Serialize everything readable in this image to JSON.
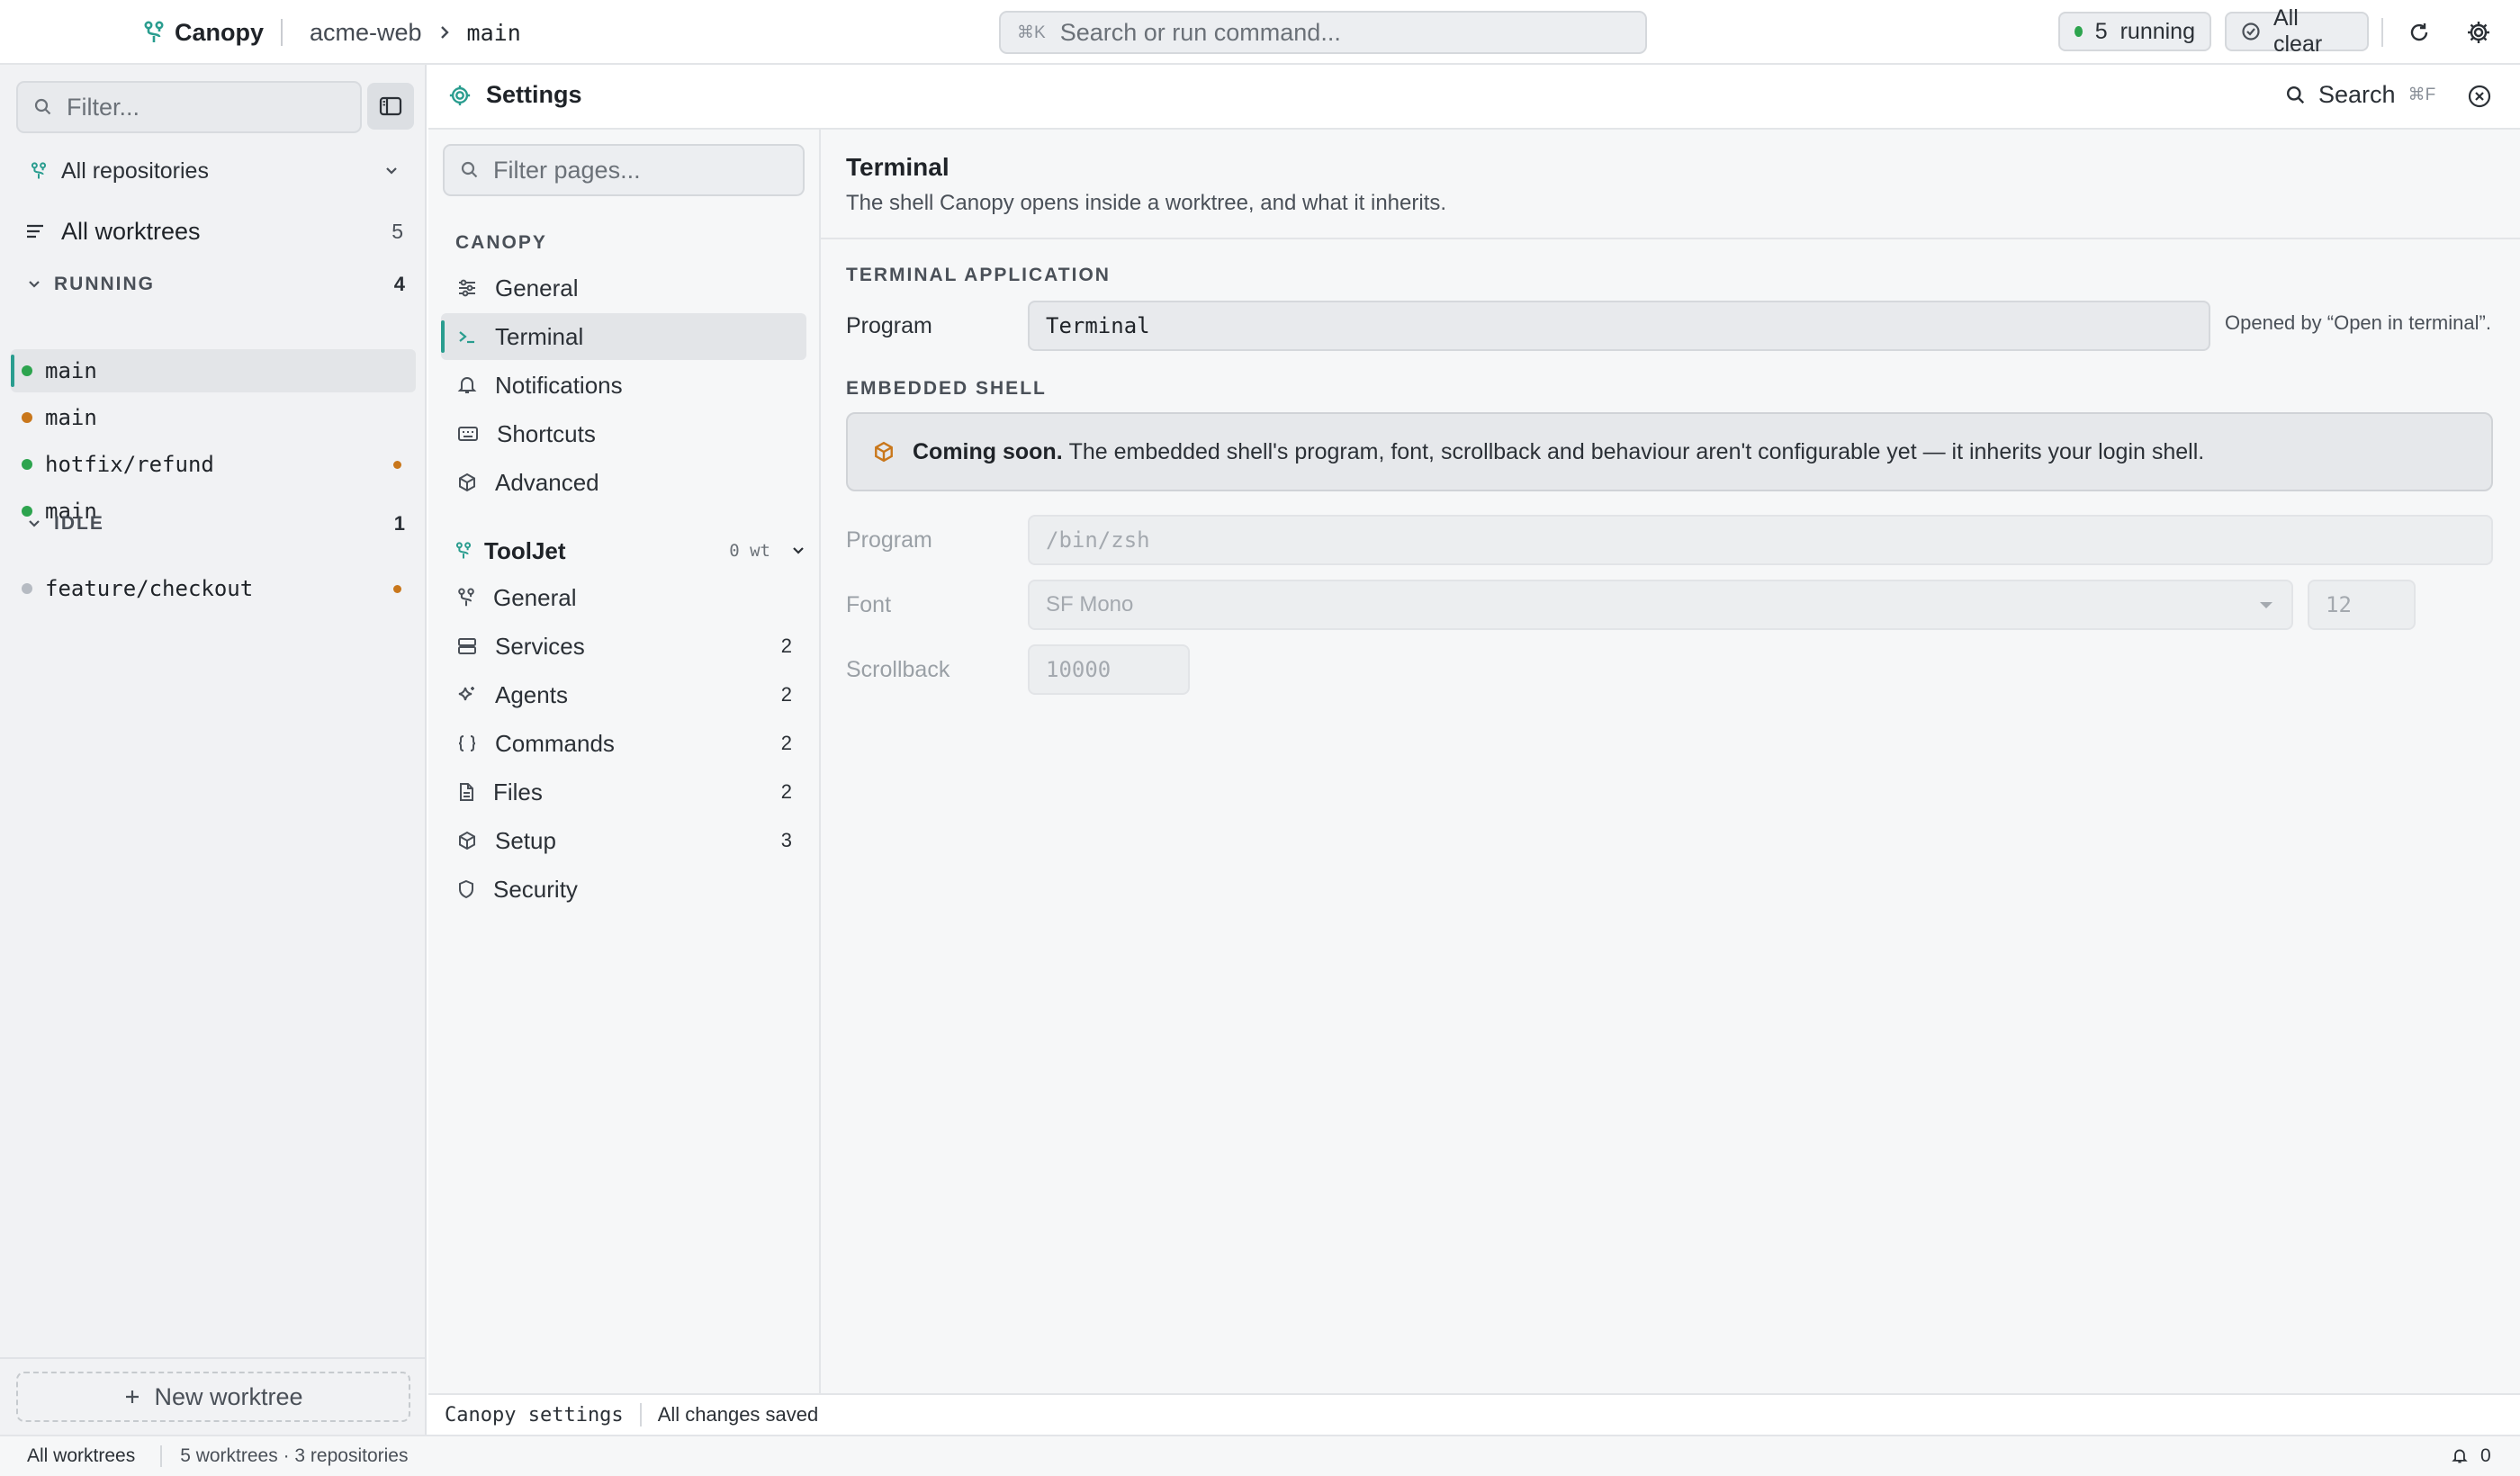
{
  "app": {
    "name": "Canopy",
    "repo": "acme-web",
    "branch": "main"
  },
  "command_bar": {
    "shortcut": "⌘K",
    "placeholder": "Search or run command..."
  },
  "status_pills": {
    "running_count": "5",
    "running_label": "running",
    "clear_label": "All clear"
  },
  "sidebar": {
    "filter_placeholder": "Filter...",
    "repo_select": "All repositories",
    "all_worktrees": {
      "label": "All worktrees",
      "count": "5"
    },
    "groups": [
      {
        "label": "RUNNING",
        "count": "4",
        "items": [
          {
            "name": "main",
            "status": "green",
            "active": true
          },
          {
            "name": "main",
            "status": "orange"
          },
          {
            "name": "hotfix/refund",
            "status": "green",
            "flag": true
          },
          {
            "name": "main",
            "status": "green"
          }
        ]
      },
      {
        "label": "IDLE",
        "count": "1",
        "items": [
          {
            "name": "feature/checkout",
            "status": "grey",
            "flag": true
          }
        ]
      }
    ],
    "new_worktree": "New worktree"
  },
  "settings": {
    "title": "Settings",
    "search_label": "Search",
    "search_shortcut": "⌘F",
    "nav": {
      "filter_placeholder": "Filter pages...",
      "section_label": "CANOPY",
      "app_items": [
        {
          "label": "General",
          "icon": "sliders-icon"
        },
        {
          "label": "Terminal",
          "icon": "terminal-icon",
          "active": true
        },
        {
          "label": "Notifications",
          "icon": "bell-icon"
        },
        {
          "label": "Shortcuts",
          "icon": "keyboard-icon"
        },
        {
          "label": "Advanced",
          "icon": "cube-icon"
        }
      ],
      "project": {
        "label": "ToolJet",
        "count": "0 wt"
      },
      "project_items": [
        {
          "label": "General",
          "icon": "branch-icon"
        },
        {
          "label": "Services",
          "icon": "server-icon",
          "count": "2"
        },
        {
          "label": "Agents",
          "icon": "sparkle-icon",
          "count": "2"
        },
        {
          "label": "Commands",
          "icon": "braces-icon",
          "count": "2"
        },
        {
          "label": "Files",
          "icon": "file-icon",
          "count": "2"
        },
        {
          "label": "Setup",
          "icon": "cube-icon",
          "count": "3"
        },
        {
          "label": "Security",
          "icon": "shield-icon"
        }
      ]
    },
    "page": {
      "title": "Terminal",
      "description": "The shell Canopy opens inside a worktree, and what it inherits.",
      "terminal_app": {
        "section": "TERMINAL APPLICATION",
        "program_label": "Program",
        "program_value": "Terminal",
        "hint": "Opened by “Open in terminal”."
      },
      "embedded_shell": {
        "section": "EMBEDDED SHELL",
        "notice_bold": "Coming soon.",
        "notice_text": "The embedded shell's program, font, scrollback and behaviour aren't configurable yet — it inherits your login shell.",
        "program_label": "Program",
        "program_placeholder": "/bin/zsh",
        "font_label": "Font",
        "font_value": "SF Mono",
        "font_size": "12",
        "scrollback_label": "Scrollback",
        "scrollback_placeholder": "10000"
      }
    }
  },
  "status_inner": {
    "left": "Canopy settings",
    "right": "All changes saved"
  },
  "status_outer": {
    "left": "All worktrees",
    "summary": "5 worktrees · 3 repositories",
    "notifications": "0"
  },
  "colors": {
    "accent": "#2a9d8f",
    "running": "#2da44e",
    "warning": "#c9771b"
  }
}
